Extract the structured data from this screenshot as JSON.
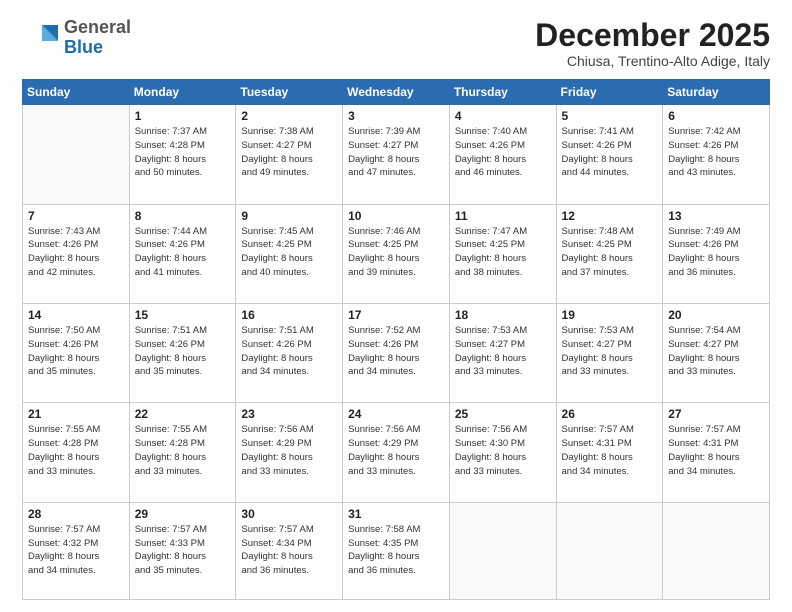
{
  "logo": {
    "general": "General",
    "blue": "Blue"
  },
  "header": {
    "month": "December 2025",
    "location": "Chiusa, Trentino-Alto Adige, Italy"
  },
  "weekdays": [
    "Sunday",
    "Monday",
    "Tuesday",
    "Wednesday",
    "Thursday",
    "Friday",
    "Saturday"
  ],
  "weeks": [
    [
      {
        "day": "",
        "info": ""
      },
      {
        "day": "1",
        "info": "Sunrise: 7:37 AM\nSunset: 4:28 PM\nDaylight: 8 hours\nand 50 minutes."
      },
      {
        "day": "2",
        "info": "Sunrise: 7:38 AM\nSunset: 4:27 PM\nDaylight: 8 hours\nand 49 minutes."
      },
      {
        "day": "3",
        "info": "Sunrise: 7:39 AM\nSunset: 4:27 PM\nDaylight: 8 hours\nand 47 minutes."
      },
      {
        "day": "4",
        "info": "Sunrise: 7:40 AM\nSunset: 4:26 PM\nDaylight: 8 hours\nand 46 minutes."
      },
      {
        "day": "5",
        "info": "Sunrise: 7:41 AM\nSunset: 4:26 PM\nDaylight: 8 hours\nand 44 minutes."
      },
      {
        "day": "6",
        "info": "Sunrise: 7:42 AM\nSunset: 4:26 PM\nDaylight: 8 hours\nand 43 minutes."
      }
    ],
    [
      {
        "day": "7",
        "info": "Sunrise: 7:43 AM\nSunset: 4:26 PM\nDaylight: 8 hours\nand 42 minutes."
      },
      {
        "day": "8",
        "info": "Sunrise: 7:44 AM\nSunset: 4:26 PM\nDaylight: 8 hours\nand 41 minutes."
      },
      {
        "day": "9",
        "info": "Sunrise: 7:45 AM\nSunset: 4:25 PM\nDaylight: 8 hours\nand 40 minutes."
      },
      {
        "day": "10",
        "info": "Sunrise: 7:46 AM\nSunset: 4:25 PM\nDaylight: 8 hours\nand 39 minutes."
      },
      {
        "day": "11",
        "info": "Sunrise: 7:47 AM\nSunset: 4:25 PM\nDaylight: 8 hours\nand 38 minutes."
      },
      {
        "day": "12",
        "info": "Sunrise: 7:48 AM\nSunset: 4:25 PM\nDaylight: 8 hours\nand 37 minutes."
      },
      {
        "day": "13",
        "info": "Sunrise: 7:49 AM\nSunset: 4:26 PM\nDaylight: 8 hours\nand 36 minutes."
      }
    ],
    [
      {
        "day": "14",
        "info": "Sunrise: 7:50 AM\nSunset: 4:26 PM\nDaylight: 8 hours\nand 35 minutes."
      },
      {
        "day": "15",
        "info": "Sunrise: 7:51 AM\nSunset: 4:26 PM\nDaylight: 8 hours\nand 35 minutes."
      },
      {
        "day": "16",
        "info": "Sunrise: 7:51 AM\nSunset: 4:26 PM\nDaylight: 8 hours\nand 34 minutes."
      },
      {
        "day": "17",
        "info": "Sunrise: 7:52 AM\nSunset: 4:26 PM\nDaylight: 8 hours\nand 34 minutes."
      },
      {
        "day": "18",
        "info": "Sunrise: 7:53 AM\nSunset: 4:27 PM\nDaylight: 8 hours\nand 33 minutes."
      },
      {
        "day": "19",
        "info": "Sunrise: 7:53 AM\nSunset: 4:27 PM\nDaylight: 8 hours\nand 33 minutes."
      },
      {
        "day": "20",
        "info": "Sunrise: 7:54 AM\nSunset: 4:27 PM\nDaylight: 8 hours\nand 33 minutes."
      }
    ],
    [
      {
        "day": "21",
        "info": "Sunrise: 7:55 AM\nSunset: 4:28 PM\nDaylight: 8 hours\nand 33 minutes."
      },
      {
        "day": "22",
        "info": "Sunrise: 7:55 AM\nSunset: 4:28 PM\nDaylight: 8 hours\nand 33 minutes."
      },
      {
        "day": "23",
        "info": "Sunrise: 7:56 AM\nSunset: 4:29 PM\nDaylight: 8 hours\nand 33 minutes."
      },
      {
        "day": "24",
        "info": "Sunrise: 7:56 AM\nSunset: 4:29 PM\nDaylight: 8 hours\nand 33 minutes."
      },
      {
        "day": "25",
        "info": "Sunrise: 7:56 AM\nSunset: 4:30 PM\nDaylight: 8 hours\nand 33 minutes."
      },
      {
        "day": "26",
        "info": "Sunrise: 7:57 AM\nSunset: 4:31 PM\nDaylight: 8 hours\nand 34 minutes."
      },
      {
        "day": "27",
        "info": "Sunrise: 7:57 AM\nSunset: 4:31 PM\nDaylight: 8 hours\nand 34 minutes."
      }
    ],
    [
      {
        "day": "28",
        "info": "Sunrise: 7:57 AM\nSunset: 4:32 PM\nDaylight: 8 hours\nand 34 minutes."
      },
      {
        "day": "29",
        "info": "Sunrise: 7:57 AM\nSunset: 4:33 PM\nDaylight: 8 hours\nand 35 minutes."
      },
      {
        "day": "30",
        "info": "Sunrise: 7:57 AM\nSunset: 4:34 PM\nDaylight: 8 hours\nand 36 minutes."
      },
      {
        "day": "31",
        "info": "Sunrise: 7:58 AM\nSunset: 4:35 PM\nDaylight: 8 hours\nand 36 minutes."
      },
      {
        "day": "",
        "info": ""
      },
      {
        "day": "",
        "info": ""
      },
      {
        "day": "",
        "info": ""
      }
    ]
  ]
}
